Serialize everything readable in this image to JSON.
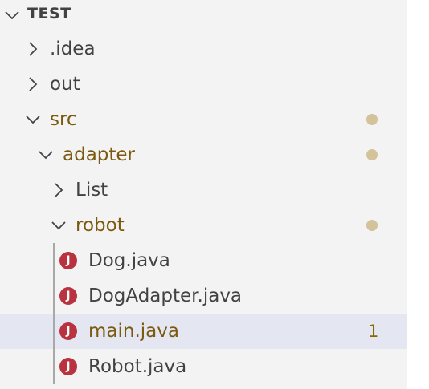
{
  "explorer": {
    "root": {
      "label": "TEST",
      "expanded": true,
      "icon": "chevron-down-icon"
    },
    "items": [
      {
        "label": ".idea",
        "type": "folder",
        "expanded": false,
        "modified": false
      },
      {
        "label": "out",
        "type": "folder",
        "expanded": false,
        "modified": false
      },
      {
        "label": "src",
        "type": "folder",
        "expanded": true,
        "modified": true,
        "decoration": "dot"
      },
      {
        "label": "adapter",
        "type": "folder",
        "expanded": true,
        "modified": true,
        "decoration": "dot"
      },
      {
        "label": "List",
        "type": "folder",
        "expanded": false,
        "modified": false
      },
      {
        "label": "robot",
        "type": "folder",
        "expanded": true,
        "modified": true,
        "decoration": "dot"
      },
      {
        "label": "Dog.java",
        "type": "file",
        "icon": "java-file-icon",
        "icon_letter": "J",
        "modified": false
      },
      {
        "label": "DogAdapter.java",
        "type": "file",
        "icon": "java-file-icon",
        "icon_letter": "J",
        "modified": false
      },
      {
        "label": "main.java",
        "type": "file",
        "icon": "java-file-icon",
        "icon_letter": "J",
        "modified": true,
        "selected": true,
        "problem_count": "1"
      },
      {
        "label": "Robot.java",
        "type": "file",
        "icon": "java-file-icon",
        "icon_letter": "J",
        "modified": false
      }
    ]
  },
  "colors": {
    "background": "#f3f3f3",
    "selected_row": "#e4e6f1",
    "modified_text": "#7b5a0f",
    "normal_text": "#424242",
    "modified_dot": "#d3c29a",
    "java_icon": "#b83240",
    "problem_count": "#8a6800"
  }
}
